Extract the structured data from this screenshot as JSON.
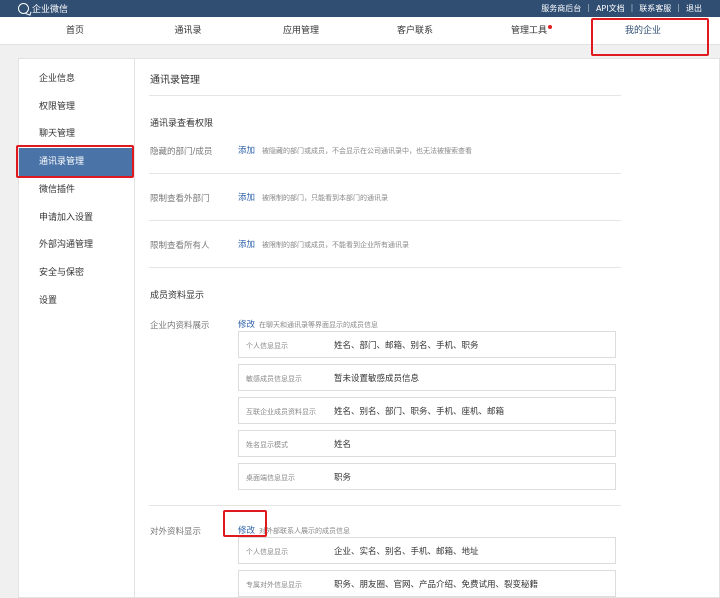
{
  "topbar": {
    "logo_text": "企业微信",
    "links": [
      "服务商后台",
      "API文档",
      "联系客服",
      "退出"
    ]
  },
  "nav": {
    "items": [
      "首页",
      "通讯录",
      "应用管理",
      "客户联系",
      "管理工具",
      "我的企业"
    ],
    "active": "我的企业"
  },
  "sidebar": {
    "items": [
      "企业信息",
      "权限管理",
      "聊天管理",
      "通讯录管理",
      "微信插件",
      "申请加入设置",
      "外部沟通管理",
      "安全与保密",
      "设置"
    ],
    "active": "通讯录管理"
  },
  "main": {
    "title": "通讯录管理",
    "view_permission": {
      "title": "通讯录查看权限",
      "rows": [
        {
          "label": "隐藏的部门/成员",
          "action": "添加",
          "desc": "被隐藏的部门或成员，不会显示在公司通讯录中，也无法被搜索查看"
        },
        {
          "label": "限制查看外部门",
          "action": "添加",
          "desc": "被限制的部门，只能看到本部门的通讯录"
        },
        {
          "label": "限制查看所有人",
          "action": "添加",
          "desc": "被限制的部门或成员，不能看到企业所有通讯录"
        }
      ]
    },
    "member_display": {
      "title": "成员资料显示",
      "internal": {
        "label": "企业内资料展示",
        "action": "修改",
        "desc": "在聊天和通讯录等界面显示的成员信息",
        "items": [
          {
            "key": "个人信息显示",
            "value": "姓名、部门、邮箱、别名、手机、职务"
          },
          {
            "key": "敏感成员信息显示",
            "value": "暂未设置敏感成员信息"
          },
          {
            "key": "互联企业成员资料显示",
            "value": "姓名、别名、部门、职务、手机、座机、邮箱"
          },
          {
            "key": "姓名显示模式",
            "value": "姓名"
          },
          {
            "key": "桌面端信息显示",
            "value": "职务"
          }
        ]
      },
      "external": {
        "label": "对外资料显示",
        "action": "修改",
        "desc": "对外部联系人展示的成员信息",
        "items": [
          {
            "key": "个人信息显示",
            "value": "企业、实名、别名、手机、邮箱、地址"
          },
          {
            "key": "专属对外信息显示",
            "value": "职务、朋友圈、官网、产品介绍、免费试用、裂变秘籍"
          }
        ]
      }
    }
  },
  "colors": {
    "topbar_bg": "#2f4e72",
    "active_sidebar_bg": "#4a73a8",
    "link": "#2c5fa8",
    "highlight": "#e0191f",
    "notification_dot": "#e02020"
  }
}
